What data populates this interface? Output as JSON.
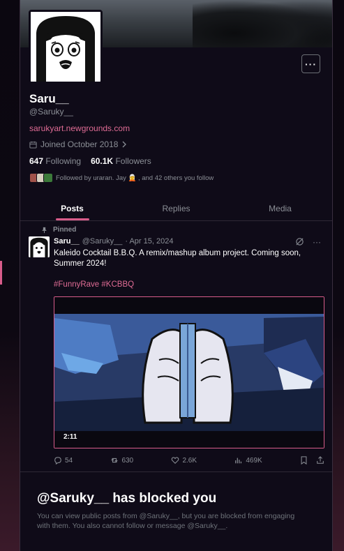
{
  "profile": {
    "name": "Saru__",
    "handle": "@Saruky__",
    "link": "sarukyart.newgrounds.com",
    "joined": "Joined October 2018",
    "following_count": "647",
    "following_label": "Following",
    "followers_count": "60.1K",
    "followers_label": "Followers",
    "followed_by": "Followed by uraran. Jay 🧝 , and 42 others you follow",
    "more_label": "···"
  },
  "tabs": [
    {
      "label": "Posts",
      "active": true
    },
    {
      "label": "Replies",
      "active": false
    },
    {
      "label": "Media",
      "active": false
    }
  ],
  "post": {
    "pinned_label": "Pinned",
    "author": "Saru__",
    "handle": "@Saruky__",
    "date": "· Apr 15, 2024",
    "text": "Kaleido Cocktail B.B.Q. A remix/mashup album project. Coming soon, Summer 2024!",
    "hashtags": "#FunnyRave #KCBBQ",
    "video_duration": "2:11",
    "replies": "54",
    "reposts": "630",
    "likes": "2.6K",
    "views": "469K"
  },
  "blocked": {
    "title": "@Saruky__ has blocked you",
    "text": "You can view public posts from @Saruky__, but you are blocked from engaging with them. You also cannot follow or message @Saruky__."
  },
  "colors": {
    "accent": "#d85c8a",
    "link": "#e06c95",
    "background": "#0f0b18"
  }
}
